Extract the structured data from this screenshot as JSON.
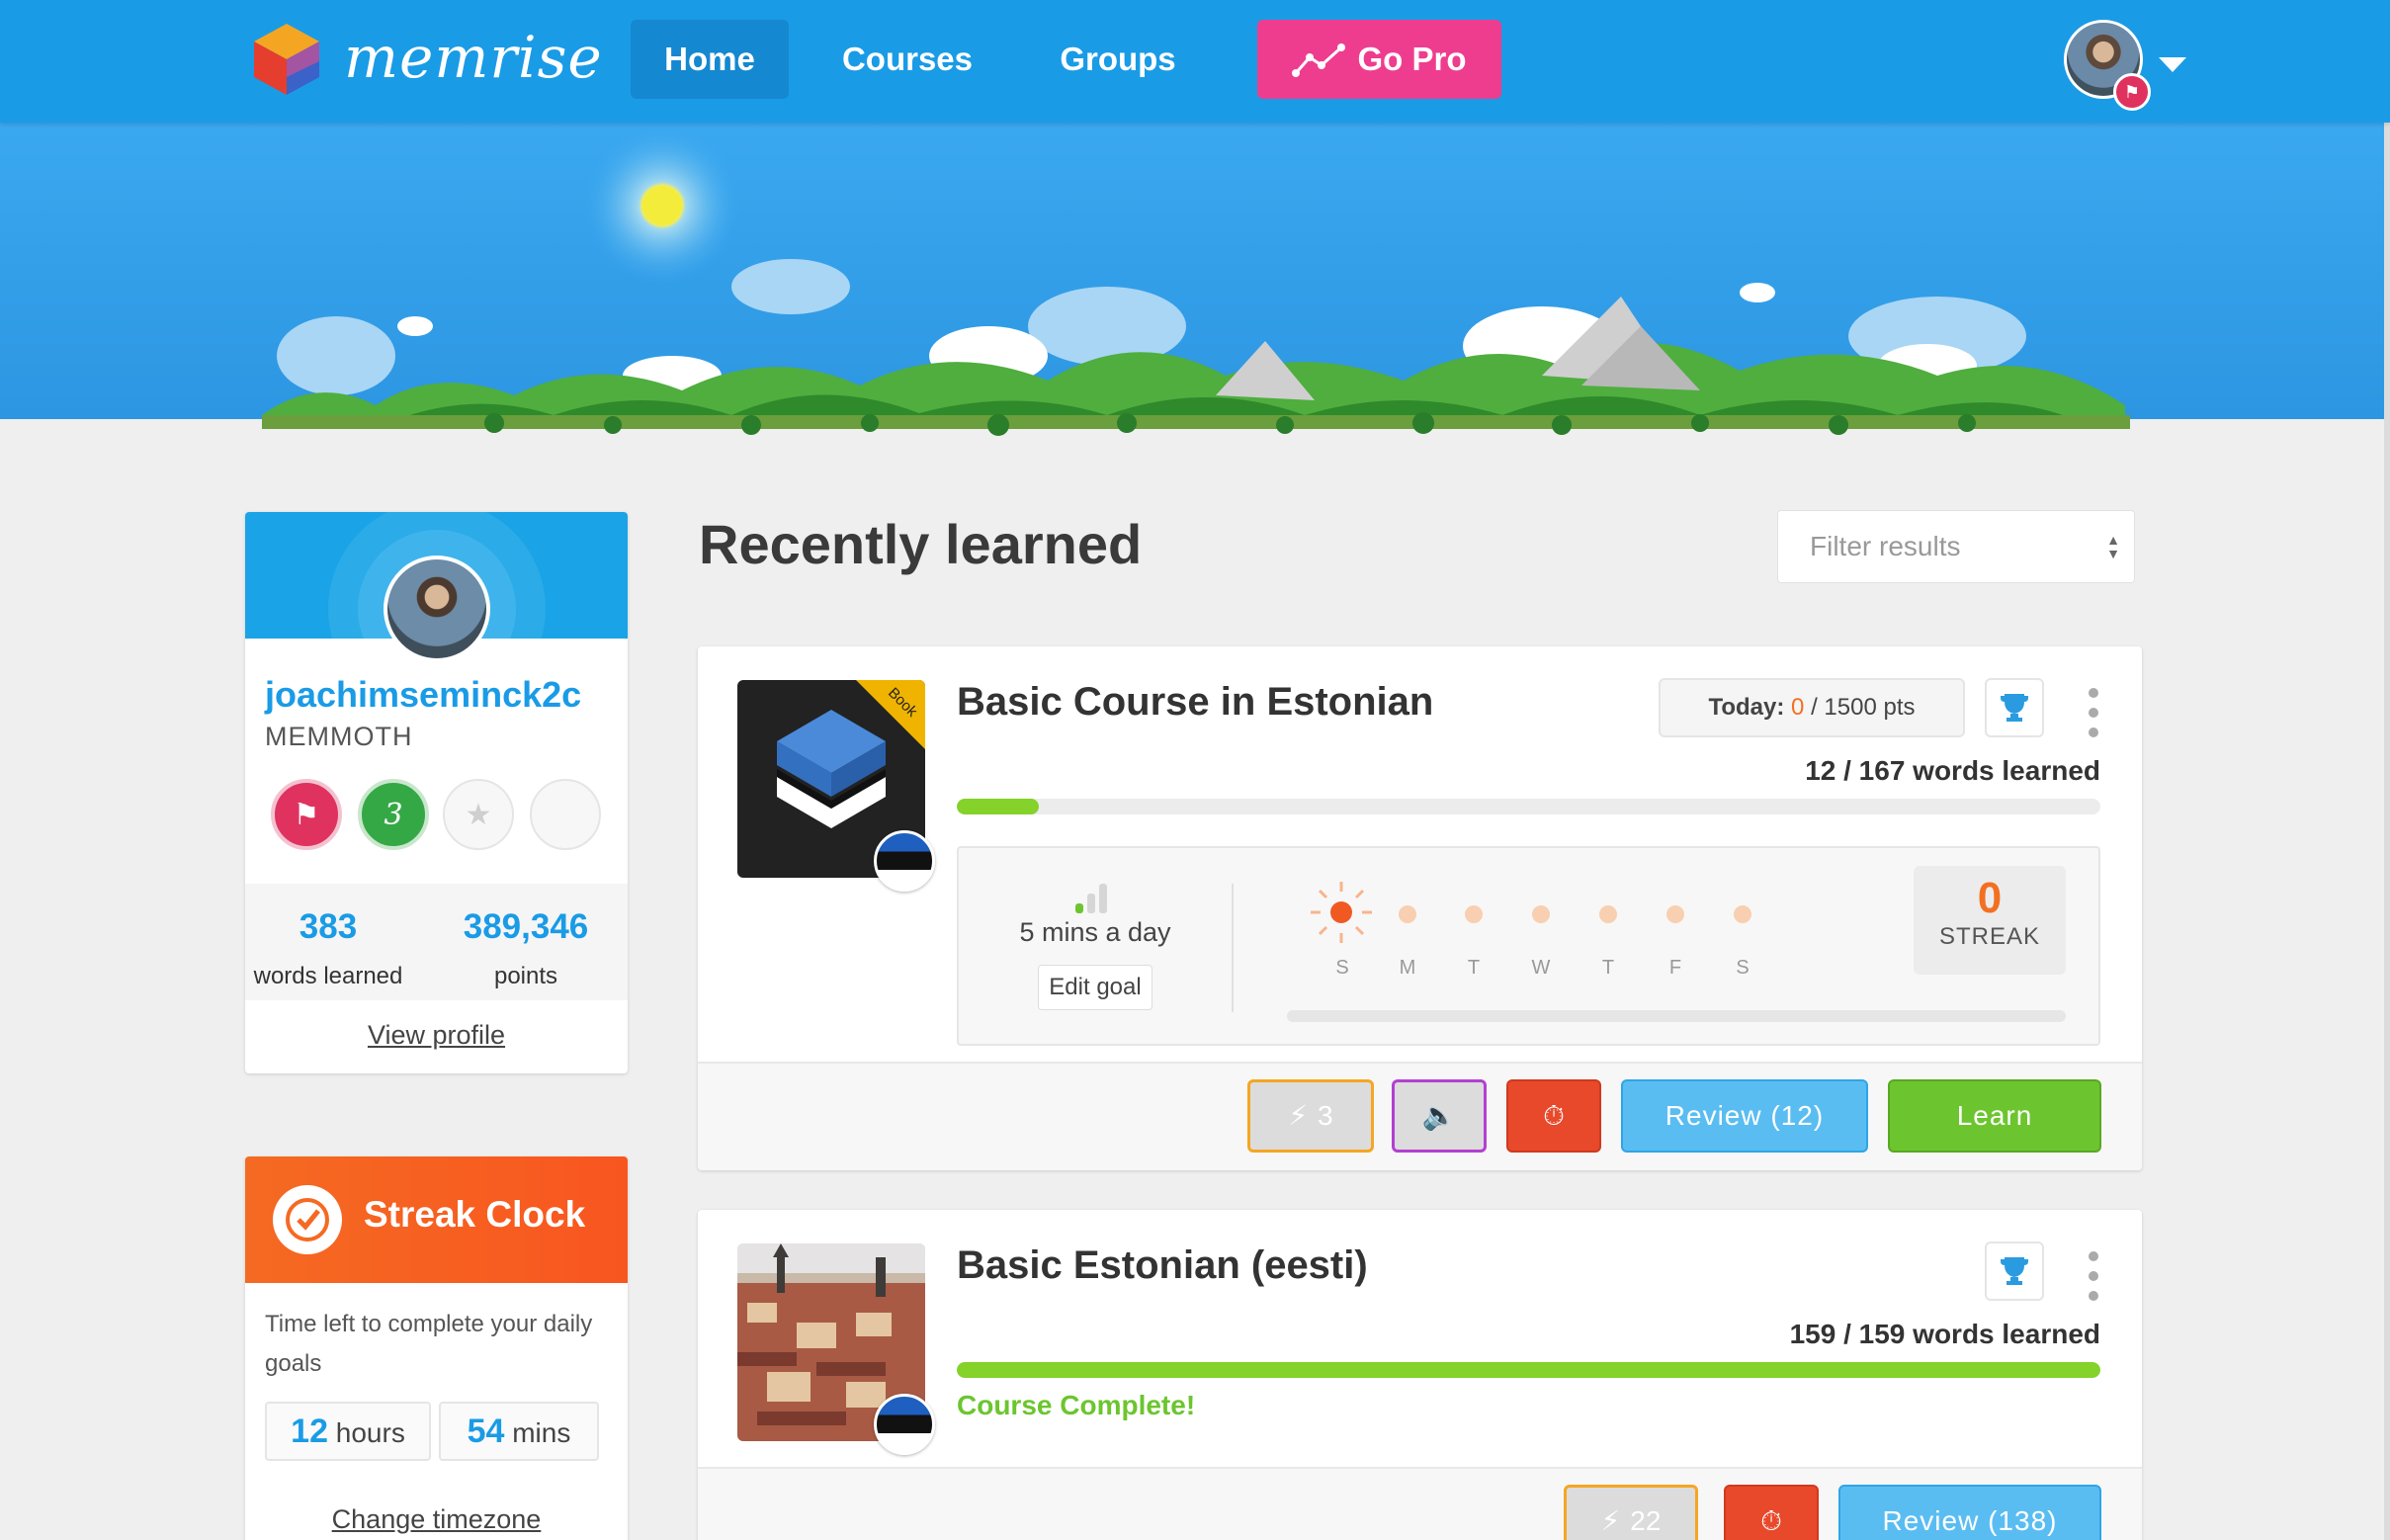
{
  "app": {
    "logo_text": "memrise"
  },
  "nav": {
    "home": "Home",
    "courses": "Courses",
    "groups": "Groups",
    "go_pro": "Go Pro"
  },
  "profile": {
    "username": "joachimseminck2c",
    "rank": "MEMMOTH",
    "badge_level": "3",
    "words_learned_value": "383",
    "words_learned_label": "words learned",
    "points_value": "389,346",
    "points_label": "points",
    "view_profile": "View profile"
  },
  "streak_clock": {
    "title": "Streak Clock",
    "description": "Time left to complete your daily goals",
    "hours_value": "12",
    "hours_label": "hours",
    "mins_value": "54",
    "mins_label": "mins",
    "change_timezone": "Change timezone"
  },
  "main": {
    "heading": "Recently learned",
    "filter_placeholder": "Filter results"
  },
  "courses": [
    {
      "title": "Basic Course in Estonian",
      "ribbon": "Book",
      "today_label": "Today:",
      "today_value": "0",
      "today_target": "/ 1500 pts",
      "words_learned": "12 / 167 words learned",
      "progress_fraction": 0.072,
      "goal_text": "5 mins a day",
      "edit_goal": "Edit goal",
      "days": [
        "S",
        "M",
        "T",
        "W",
        "T",
        "F",
        "S"
      ],
      "streak_value": "0",
      "streak_label": "STREAK",
      "speed_count": "3",
      "review_label": "Review (12)",
      "learn_label": "Learn"
    },
    {
      "title": "Basic Estonian (eesti)",
      "words_learned": "159 / 159 words learned",
      "progress_fraction": 1.0,
      "complete_label": "Course Complete!",
      "speed_count": "22",
      "review_label": "Review (138)"
    }
  ],
  "colors": {
    "brand_blue": "#1a9be6",
    "go_pro_pink": "#ee3d8f",
    "streak_orange": "#f56a22",
    "progress_green": "#84d22a",
    "learn_green": "#6cc52e"
  }
}
